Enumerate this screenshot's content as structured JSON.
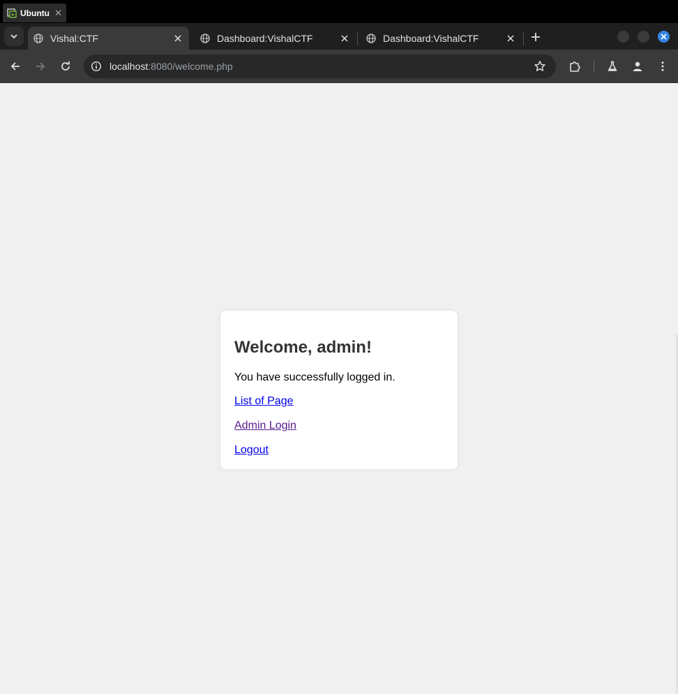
{
  "os": {
    "tab_label": "Ubuntu",
    "tab_close": "✕"
  },
  "browser": {
    "tabs": [
      {
        "title": "Vishal:CTF",
        "active": true
      },
      {
        "title": "Dashboard:VishalCTF",
        "active": false
      },
      {
        "title": "Dashboard:VishalCTF",
        "active": false
      }
    ],
    "address": {
      "host": "localhost",
      "path": ":8080/welcome.php"
    }
  },
  "page": {
    "heading": "Welcome, admin!",
    "message": "You have successfully logged in.",
    "links": [
      {
        "label": "List of Page",
        "visited": false
      },
      {
        "label": "Admin Login",
        "visited": true
      },
      {
        "label": "Logout",
        "visited": false
      }
    ]
  },
  "colors": {
    "link": "#0000ee",
    "link_visited": "#551a8b",
    "page_bg": "#f0f0f0",
    "window_close": "#3584e4"
  }
}
